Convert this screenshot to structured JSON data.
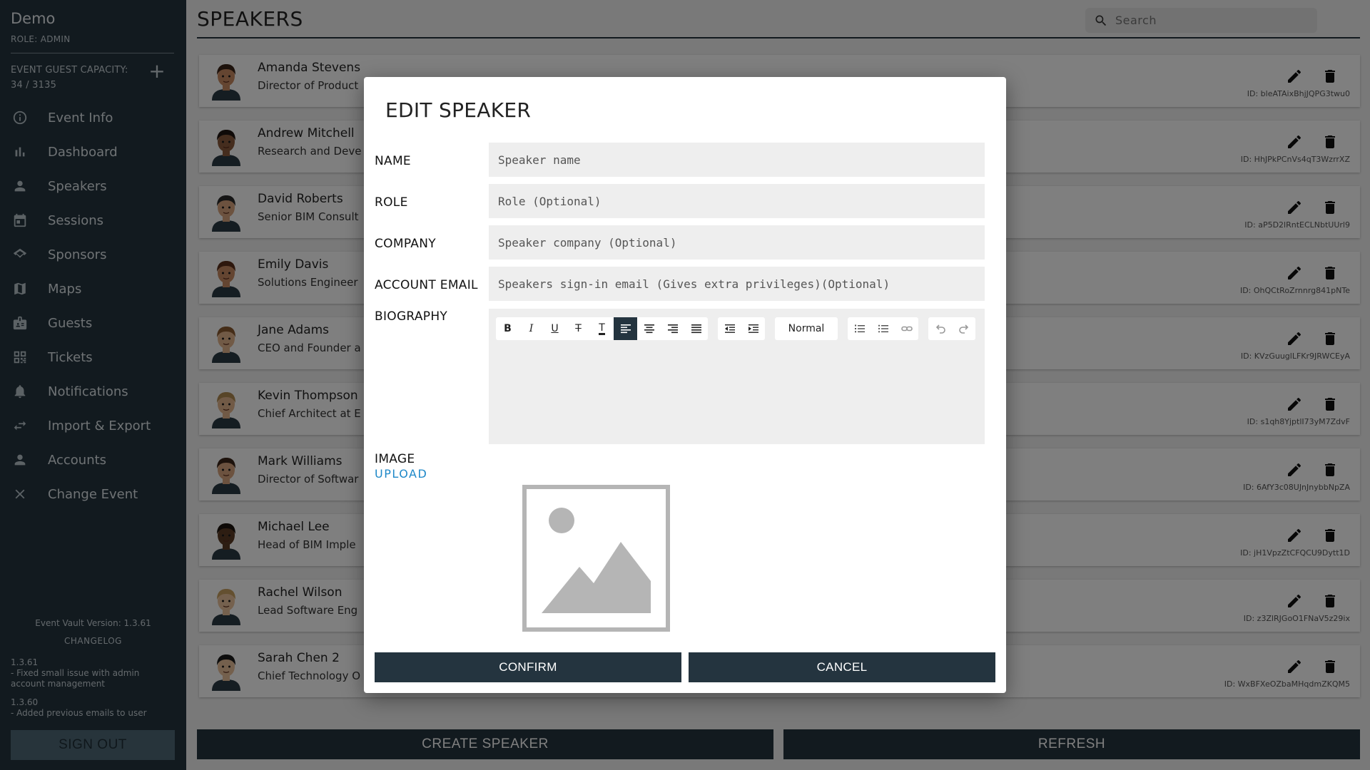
{
  "sidebar": {
    "app_title": "Demo",
    "role": "ROLE: ADMIN",
    "capacity_label": "EVENT GUEST CAPACITY:",
    "capacity_value": "34 / 3135",
    "capacity_add_icon": "plus-icon",
    "nav": [
      {
        "label": "Event Info",
        "icon": "info-icon"
      },
      {
        "label": "Dashboard",
        "icon": "bar-chart-icon"
      },
      {
        "label": "Speakers",
        "icon": "person-icon"
      },
      {
        "label": "Sessions",
        "icon": "calendar-icon"
      },
      {
        "label": "Sponsors",
        "icon": "handshake-icon"
      },
      {
        "label": "Maps",
        "icon": "map-icon"
      },
      {
        "label": "Guests",
        "icon": "badge-icon"
      },
      {
        "label": "Tickets",
        "icon": "qr-code-icon"
      },
      {
        "label": "Notifications",
        "icon": "bell-icon"
      },
      {
        "label": "Import & Export",
        "icon": "swap-icon"
      },
      {
        "label": "Accounts",
        "icon": "person-icon"
      },
      {
        "label": "Change Event",
        "icon": "close-icon"
      }
    ],
    "version": "Event Vault Version: 1.3.61",
    "changelog_label": "CHANGELOG",
    "changelog": [
      {
        "version": "1.3.61",
        "note": "- Fixed small issue with admin account management"
      },
      {
        "version": "1.3.60",
        "note": "- Added previous emails to user"
      }
    ],
    "sign_out": "SIGN OUT"
  },
  "main": {
    "title": "SPEAKERS",
    "search_placeholder": "Search",
    "speakers": [
      {
        "name": "Amanda Stevens",
        "role": "Director of Product",
        "id": "ID: bleATAixBhjJQPG3twu0",
        "skin": "#c98b62",
        "hair": "#3a2418"
      },
      {
        "name": "Andrew Mitchell",
        "role": "Research and Deve",
        "id": "ID: HhJPkPCnVs4qT3WzrrXZ",
        "skin": "#8a5a3c",
        "hair": "#1e1410"
      },
      {
        "name": "David Roberts",
        "role": "Senior BIM Consult",
        "id": "ID: aP5D2lRntECLNbtUUrl9",
        "skin": "#d9a57e",
        "hair": "#2a2a2a"
      },
      {
        "name": "Emily Davis",
        "role": "Solutions Engineer",
        "id": "ID: OhQCtRoZrnnrg841pNTe",
        "skin": "#c98b62",
        "hair": "#5a2e1a"
      },
      {
        "name": "Jane Adams",
        "role": "CEO and Founder a",
        "id": "ID: KVzGuuglLFKr9JRWCEyA",
        "skin": "#e2b48c",
        "hair": "#8a5a30"
      },
      {
        "name": "Kevin Thompson",
        "role": "Chief Architect at E",
        "id": "ID: s1qh8YjptlI73yM7ZdvF",
        "skin": "#e2b48c",
        "hair": "#b08a50"
      },
      {
        "name": "Mark Williams",
        "role": "Director of Softwar",
        "id": "ID: 6AfY3c08UJnJnybbNpZA",
        "skin": "#d9a57e",
        "hair": "#3a2418"
      },
      {
        "name": "Michael Lee",
        "role": "Head of BIM Imple",
        "id": "ID: jH1VpzZtCFQCU9Dytt1D",
        "skin": "#5a3a24",
        "hair": "#1a120c"
      },
      {
        "name": "Rachel Wilson",
        "role": "Lead Software Eng",
        "id": "ID: z3ZlRJGoO1FNaV5z29ix",
        "skin": "#eac39c",
        "hair": "#c9a060"
      },
      {
        "name": "Sarah Chen 2",
        "role": "Chief Technology O",
        "id": "ID: WxBFXeOZbaMHqdmZKQM5",
        "skin": "#e8c09a",
        "hair": "#1a1a1a"
      }
    ],
    "create_button": "CREATE SPEAKER",
    "refresh_button": "REFRESH"
  },
  "modal": {
    "title": "EDIT SPEAKER",
    "name_label": "NAME",
    "name_placeholder": "Speaker name",
    "role_label": "ROLE",
    "role_placeholder": "Role (Optional)",
    "company_label": "COMPANY",
    "company_placeholder": "Speaker company (Optional)",
    "email_label": "ACCOUNT EMAIL",
    "email_placeholder": "Speakers sign-in email (Gives extra privileges)(Optional)",
    "bio_label": "BIOGRAPHY",
    "bio_toolbar": {
      "format_select": "Normal",
      "active_align": "align-left"
    },
    "image_label": "IMAGE",
    "upload_label": "UPLOAD",
    "confirm": "CONFIRM",
    "cancel": "CANCEL"
  }
}
